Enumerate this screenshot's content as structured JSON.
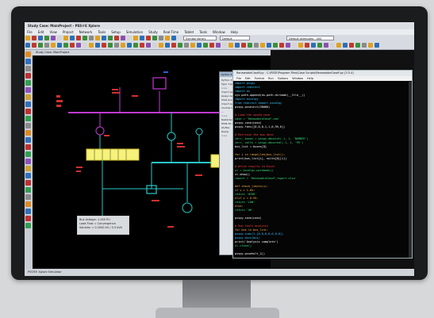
{
  "window": {
    "title": "Study Case: MainProject - PSS®E Xplore"
  },
  "menubar": [
    "File",
    "Edit",
    "View",
    "Project",
    "Network",
    "Tools",
    "Setup",
    "Simulation",
    "Study",
    "Real-Time",
    "Tablet",
    "Tools",
    "Window",
    "Help"
  ],
  "toolbar": {
    "combo1": "Symbol library",
    "combo2": "Default",
    "combo3": "Default Attributes - 400",
    "icon_colors": [
      "#e0a020",
      "#c0392b",
      "#2d6fb6",
      "#3a8f3a",
      "#8a4fb0",
      "#d4d4d4",
      "#e0a020",
      "#2d6fb6",
      "#c0392b",
      "#3a8f3a",
      "#8a8a8a",
      "#e0a020",
      "#2d6fb6",
      "#3a8f3a",
      "#c0392b",
      "#8a4fb0",
      "#d4d4d4",
      "#e0a020",
      "#2d6fb6",
      "#c0392b",
      "#3a8f3a",
      "#8a8a8a",
      "#e0a020",
      "#2d6fb6",
      "#3a8f3a",
      "#c0392b",
      "#8a4fb0",
      "#d4d4d4",
      "#e0a020",
      "#2d6fb6",
      "#c0392b",
      "#3a8f3a",
      "#8a8a8a",
      "#e0a020",
      "#2d6fb6",
      "#3a8f3a",
      "#c0392b",
      "#8a4fb0",
      "#d4d4d4",
      "#e0a020",
      "#2d6fb6",
      "#c0392b",
      "#3a8f3a",
      "#8a8a8a",
      "#e0a020",
      "#2d6fb6",
      "#3a8f3a",
      "#c0392b",
      "#8a4fb0",
      "#d4d4d4"
    ]
  },
  "left_tools": [
    "#e08a20",
    "#3070c0",
    "#8a8a8a",
    "#c03030",
    "#30a050",
    "#9050c0",
    "#d0a030",
    "#3070c0",
    "#c03030",
    "#30a050",
    "#8a8a8a",
    "#e08a20",
    "#3070c0",
    "#c03030",
    "#30a050",
    "#9050c0",
    "#d0a030",
    "#3070c0",
    "#c03030",
    "#30a050",
    "#8a8a8a",
    "#e08a20",
    "#3070c0",
    "#c03030",
    "#30a050"
  ],
  "canvas": {
    "tab": "Study Case: MainProject"
  },
  "infobox": {
    "line1": "Bus Voltage: 1.000 PU",
    "line2": "Load Flow = Convergence",
    "line3": "Solution = 0.2000 kV / 0.5 kVA"
  },
  "propwin": {
    "title": "Python 3.5.4 Shell",
    "lines": [
      "Python 3.5.4",
      "Type 'copyright'",
      ">>>",
      "import psspy",
      "psspy.case()",
      "Shell prompt",
      "import sys",
      "module loaded",
      "...",
      ">>>",
      "Restarted",
      "PSSE 35 API",
      "(Pyfile)",
      "Ready",
      ">>>"
    ]
  },
  "terminal": {
    "title": "RenewableCaseF.py - C:\\PSSE\\Program Files\\Case Scripts\\RenewableCaseF.py (3.5.4)",
    "menu": [
      "File",
      "Edit",
      "Format",
      "Run",
      "Options",
      "Window",
      "Help"
    ],
    "lines": [
      {
        "t": "import psspy",
        "c": "#39c8ff"
      },
      {
        "t": "import redirect",
        "c": "#39c8ff"
      },
      {
        "t": "import os",
        "c": "#39c8ff"
      },
      {
        "t": "sys.path.append(os.path.dirname(__file__))",
        "c": "#ffffff"
      },
      {
        "t": "import excelpy",
        "c": "#39c8ff"
      },
      {
        "t": "from redirect import psse2py",
        "c": "#39c8ff"
      },
      {
        "t": "psspy.psseinit(50000)",
        "c": "#ffffff"
      },
      {
        "t": "",
        "c": "#ffffff"
      },
      {
        "t": "# Load the saved case",
        "c": "#ff4040"
      },
      {
        "t": "case = 'RenewableCaseF.sav'",
        "c": "#39e07a"
      },
      {
        "t": "psspy.case(case)",
        "c": "#ffffff"
      },
      {
        "t": "psspy.fdns([0,0,0,1,1,0,99,0])",
        "c": "#ffffff"
      },
      {
        "t": "",
        "c": "#ffffff"
      },
      {
        "t": "# Retrieve the bus data",
        "c": "#ff4040"
      },
      {
        "t": "ierr, buses = psspy.abusint(-1, 1, 'NUMBER')",
        "c": "#39e07a"
      },
      {
        "t": "ierr, volts = psspy.abusreal(-1, 1, 'PU')",
        "c": "#39e07a"
      },
      {
        "t": "bus_list = buses[0]",
        "c": "#ffffff"
      },
      {
        "t": "",
        "c": "#ffffff"
      },
      {
        "t": "for i in range(len(bus_list)):",
        "c": "#ffb347"
      },
      {
        "t": "    print(bus_list[i], volts[0][i])",
        "c": "#ffffff"
      },
      {
        "t": "",
        "c": "#ffffff"
      },
      {
        "t": "# Write results to Excel",
        "c": "#ff4040"
      },
      {
        "t": "xl = excelpy.workbook()",
        "c": "#39e07a"
      },
      {
        "t": "xl.show()",
        "c": "#ffffff"
      },
      {
        "t": "report = 'RenewableCaseF_report.xlsx'",
        "c": "#39e07a"
      },
      {
        "t": "",
        "c": "#ffffff"
      },
      {
        "t": "def check_limits(v):",
        "c": "#ffb347"
      },
      {
        "t": "    if v > 1.05:",
        "c": "#ffb347"
      },
      {
        "t": "        return 'HIGH'",
        "c": "#39e07a"
      },
      {
        "t": "    elif v < 0.95:",
        "c": "#ffb347"
      },
      {
        "t": "        return 'LOW'",
        "c": "#39e07a"
      },
      {
        "t": "    else:",
        "c": "#ffb347"
      },
      {
        "t": "        return 'OK'",
        "c": "#39e07a"
      },
      {
        "t": "",
        "c": "#ffffff"
      },
      {
        "t": "psspy.save(case)",
        "c": "#ffffff"
      },
      {
        "t": "",
        "c": "#ffffff"
      },
      {
        "t": "# Run fault analysis",
        "c": "#ff4040"
      },
      {
        "t": "for bus in bus_list:",
        "c": "#ffb347"
      },
      {
        "t": "    psspy.scmu(1,[0,0,0,0,0,0,0])",
        "c": "#39c8ff"
      },
      {
        "t": "psspy.dscn(bus)",
        "c": "#39c8ff"
      },
      {
        "t": "print('Analysis complete')",
        "c": "#ffffff"
      },
      {
        "t": "xl.close()",
        "c": "#39e07a"
      },
      {
        "t": "",
        "c": "#ffffff"
      },
      {
        "t": "psspy.pssehalt_2()",
        "c": "#ffffff"
      }
    ]
  },
  "statusbar": {
    "text": "PSS®E  Xplore  Simulator"
  }
}
